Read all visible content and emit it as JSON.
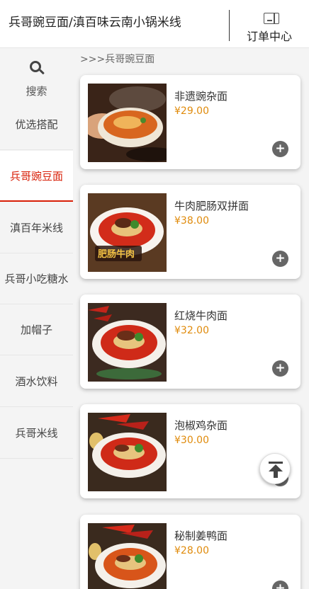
{
  "header": {
    "shop_title": "兵哥豌豆面/滇百味云南小锅米线",
    "orders_label": "订单中心"
  },
  "sidebar": {
    "search_label": "搜索",
    "categories": [
      {
        "label": "优选搭配"
      },
      {
        "label": "兵哥豌豆面",
        "active": true
      },
      {
        "label": "滇百年米线"
      },
      {
        "label": "兵哥小吃糖水"
      },
      {
        "label": "加帽子"
      },
      {
        "label": "酒水饮料"
      },
      {
        "label": "兵哥米线"
      }
    ]
  },
  "main": {
    "breadcrumb": ">>>兵哥豌豆面",
    "add_label": "+",
    "products": [
      {
        "name": "非遗豌杂面",
        "price": "¥29.00",
        "image_text": ""
      },
      {
        "name": "牛肉肥肠双拼面",
        "price": "¥38.00",
        "image_text": "肥肠牛肉"
      },
      {
        "name": "红烧牛肉面",
        "price": "¥32.00",
        "image_text": ""
      },
      {
        "name": "泡椒鸡杂面",
        "price": "¥30.00",
        "image_text": ""
      },
      {
        "name": "秘制姜鸭面",
        "price": "¥28.00",
        "image_text": ""
      }
    ]
  },
  "colors": {
    "accent": "#d81e06",
    "price": "#e08b0c",
    "add_button": "#666666"
  },
  "icons": {
    "orders": "receipt-icon",
    "search": "search-icon",
    "add": "plus-icon",
    "back_to_top": "arrow-up-to-top-icon"
  }
}
